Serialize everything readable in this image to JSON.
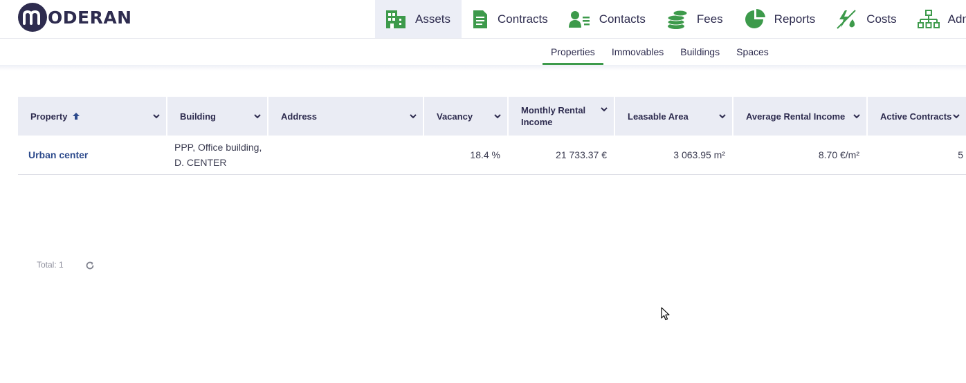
{
  "brand": {
    "name": "ODERAN",
    "mark": "m",
    "mark_icon": "moderan-logo-icon"
  },
  "nav": [
    {
      "label": "Assets",
      "icon": "building-icon",
      "active": true
    },
    {
      "label": "Contracts",
      "icon": "document-icon",
      "active": false
    },
    {
      "label": "Contacts",
      "icon": "contacts-icon",
      "active": false
    },
    {
      "label": "Fees",
      "icon": "coins-icon",
      "active": false
    },
    {
      "label": "Reports",
      "icon": "pie-chart-icon",
      "active": false
    },
    {
      "label": "Costs",
      "icon": "costs-icon",
      "active": false
    },
    {
      "label": "Admin",
      "icon": "hierarchy-icon",
      "active": false
    }
  ],
  "subtabs": [
    {
      "label": "Properties",
      "active": true
    },
    {
      "label": "Immovables",
      "active": false
    },
    {
      "label": "Buildings",
      "active": false
    },
    {
      "label": "Spaces",
      "active": false
    }
  ],
  "table": {
    "columns": [
      {
        "label": "Property",
        "sorted": "ascending"
      },
      {
        "label": "Building"
      },
      {
        "label": "Address"
      },
      {
        "label": "Vacancy"
      },
      {
        "label": "Monthly Rental Income"
      },
      {
        "label": "Leasable Area"
      },
      {
        "label": "Average Rental Income"
      },
      {
        "label": "Active Contracts"
      }
    ],
    "rows": [
      {
        "property": "Urban center",
        "building_line1": "PPP, Office building,",
        "building_line2": "D. CENTER",
        "address": "",
        "vacancy": "18.4 %",
        "monthly_rental_income": "21 733.37 €",
        "leasable_area": "3 063.95 m²",
        "average_rental_income": "8.70 €/m²",
        "active_contracts": "5"
      }
    ]
  },
  "footer": {
    "total": "Total: 1"
  },
  "colors": {
    "brand": "#2e2c4f",
    "accent": "#3d9a4b",
    "link": "#2c4a8c",
    "header_bg": "#eaecf4"
  }
}
